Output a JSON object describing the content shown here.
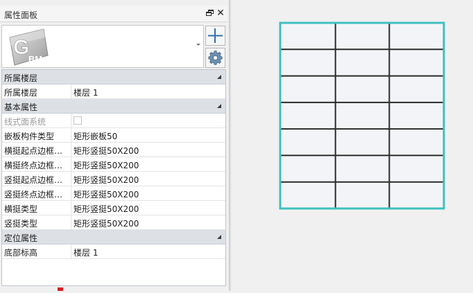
{
  "panel": {
    "title": "属性面板",
    "float_icon": "float-window-icon",
    "close_label": "✕"
  },
  "type_selector": {
    "logo_letter": "G",
    "logo_sub": "BM",
    "icon": "gbm-logo-icon"
  },
  "side_buttons": {
    "add_icon": "plus-icon",
    "settings_icon": "gear-icon"
  },
  "groups": {
    "floor": {
      "title": "所属楼层",
      "rows": [
        {
          "name": "所属楼层",
          "value": "楼层 1"
        }
      ]
    },
    "basic": {
      "title": "基本属性",
      "rows": [
        {
          "name": "线式面系统",
          "value": ""
        },
        {
          "name": "嵌板构件类型",
          "value": "矩形嵌板50"
        },
        {
          "name": "横挺起点边框…",
          "value": "矩形竖挺50X200"
        },
        {
          "name": "横挺终点边框…",
          "value": "矩形竖挺50X200"
        },
        {
          "name": "竖挺起点边框…",
          "value": "矩形竖挺50X200"
        },
        {
          "name": "竖挺终点边框…",
          "value": "矩形竖挺50X200"
        },
        {
          "name": "横挺类型",
          "value": "矩形竖挺50X200"
        },
        {
          "name": "竖挺类型",
          "value": "矩形竖挺50X200"
        }
      ]
    },
    "position": {
      "title": "定位属性",
      "rows": [
        {
          "name": "底部标高",
          "value": "楼层 1"
        }
      ]
    }
  },
  "colors": {
    "frame_outline": "#3fbfbf",
    "mullion": "#2a2a2a",
    "panel_fill": "#f3f4f7",
    "group_header": "#dde1e6"
  },
  "curtain_wall": {
    "columns": 3,
    "rows": 7
  }
}
